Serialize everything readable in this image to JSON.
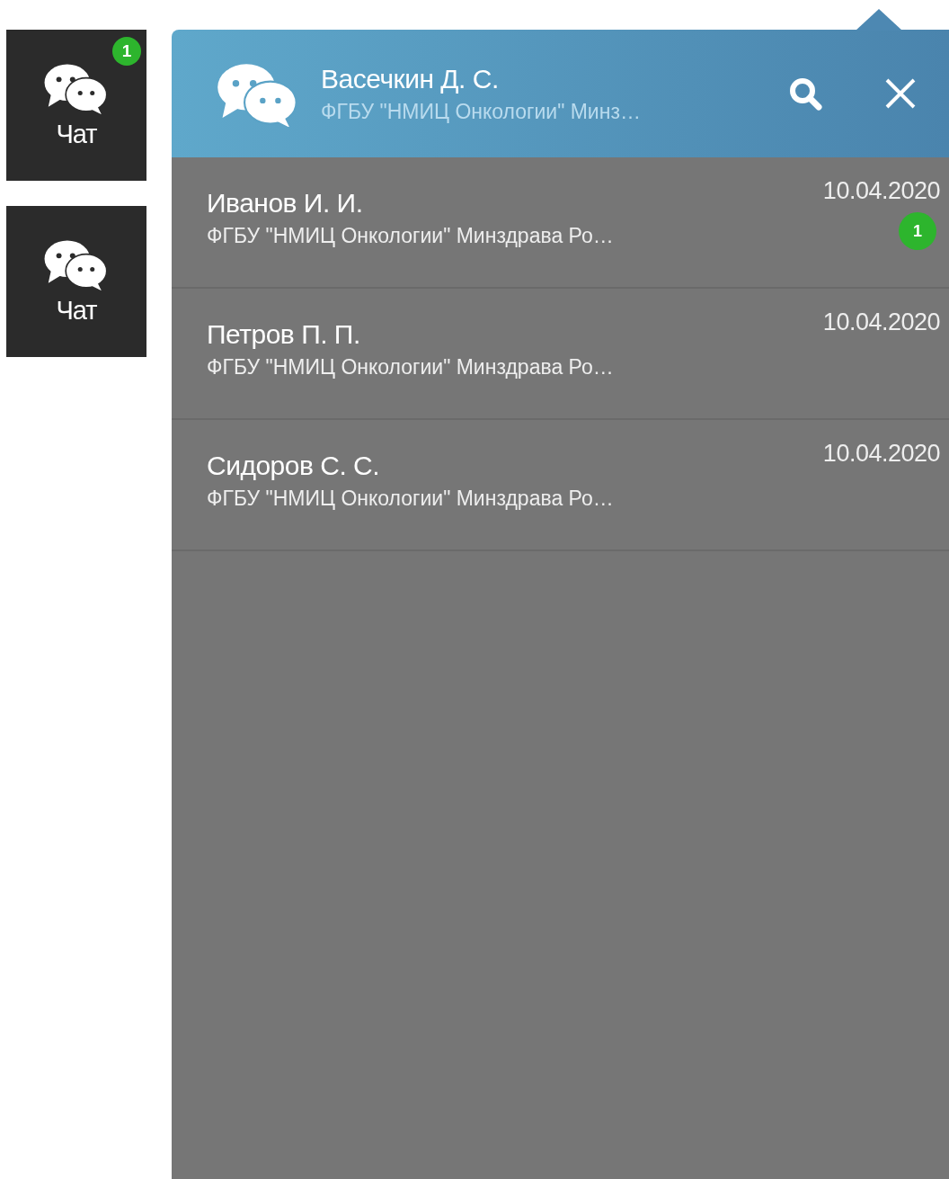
{
  "launchers": [
    {
      "label": "Чат",
      "badge": "1"
    },
    {
      "label": "Чат"
    }
  ],
  "panel": {
    "header": {
      "name": "Васечкин Д. С.",
      "organization": "ФГБУ \"НМИЦ Онкологии\" Минз…"
    },
    "chats": [
      {
        "name": "Иванов И. И.",
        "organization": "ФГБУ \"НМИЦ Онкологии\" Минздрава Ро…",
        "date": "10.04.2020",
        "unread": "1"
      },
      {
        "name": "Петров П. П.",
        "organization": "ФГБУ \"НМИЦ Онкологии\" Минздрава Ро…",
        "date": "10.04.2020"
      },
      {
        "name": "Сидоров С. С.",
        "organization": "ФГБУ \"НМИЦ Онкологии\" Минздрава Ро…",
        "date": "10.04.2020"
      }
    ]
  }
}
